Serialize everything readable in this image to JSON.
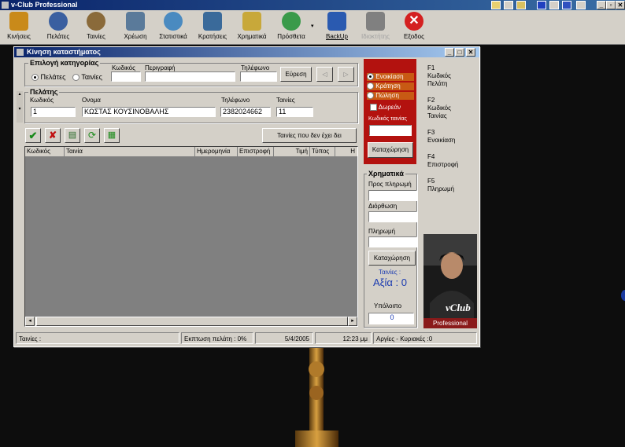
{
  "app": {
    "title": "v-Club Professional"
  },
  "toolbar": {
    "items": [
      {
        "label": "Κινήσεις",
        "color": "#c98a1a",
        "enabled": true
      },
      {
        "label": "Πελάτες",
        "color": "#3a5fa0",
        "enabled": true
      },
      {
        "label": "Ταινίες",
        "color": "#8a6a3a",
        "enabled": true
      },
      {
        "label": "Χρέωση",
        "color": "#5a7a9a",
        "enabled": true
      },
      {
        "label": "Στατιστικά",
        "color": "#4a8ac0",
        "enabled": true
      },
      {
        "label": "Κρατήσεις",
        "color": "#3a6a9a",
        "enabled": true
      },
      {
        "label": "Χρηματικά",
        "color": "#c8a83a",
        "enabled": true
      },
      {
        "label": "Πρόσθετα",
        "color": "#3a9a4a",
        "enabled": true
      },
      {
        "label": "BackUp",
        "color": "#2a5ab0",
        "enabled": true
      },
      {
        "label": "Ιδιοκτήτης",
        "color": "#808080",
        "enabled": false
      },
      {
        "label": "Εξοδος",
        "color": "#d42020",
        "enabled": true
      }
    ]
  },
  "window": {
    "title": "Κίνηση καταστήματος",
    "category": {
      "group_label": "Επιλογή κατηγορίας",
      "opt_customers": "Πελάτες",
      "opt_movies": "Ταινίες",
      "code_label": "Κωδικός",
      "desc_label": "Περιγραφή",
      "phone_label": "Τηλέφωνο",
      "search_button": "Εύρεση"
    },
    "customer": {
      "group_label": "Πελάτης",
      "code_label": "Κωδικός",
      "code_value": "1",
      "name_label": "Ονομα",
      "name_value": "ΚΩΣΤΑΣ ΚΟΥΣΙΝΟΒΑΛΗΣ",
      "phone_label": "Τηλέφωνο",
      "phone_value": "2382024662",
      "movies_label": "Ταινίες",
      "movies_value": "11"
    },
    "not_had_button": "Ταινίες που δεν έχει δει",
    "grid_columns": [
      "Κωδικός",
      "Ταινία",
      "Ημερομηνία",
      "Επιστροφή",
      "Τιμή",
      "Τύπος",
      "Η"
    ],
    "rental": {
      "opt_rent": "Ενοικίαση",
      "opt_reserve": "Κράτηση",
      "opt_sale": "Πώληση",
      "free_label": "Δωρεάν",
      "movie_code_label": "Κωδικός ταινίας",
      "save_button": "Καταχώρηση"
    },
    "money": {
      "group_label": "Χρηματικά",
      "to_pay_label": "Προς πληρωμή",
      "correction_label": "Διόρθωση",
      "payment_label": "Πληρωμή",
      "save_button": "Καταχώρηση",
      "movies_label": "Ταινίες :",
      "value_label": "Αξία : 0",
      "balance_label": "Υπόλοιπο",
      "balance_value": "0"
    },
    "shortcuts": [
      {
        "key": "F1",
        "text": "Κωδικός Πελάτη"
      },
      {
        "key": "F2",
        "text": "Κωδικός Ταινίας"
      },
      {
        "key": "F3",
        "text": "Ενοικίαση"
      },
      {
        "key": "F4",
        "text": "Επιστροφή"
      },
      {
        "key": "F5",
        "text": "Πληρωμή"
      }
    ],
    "photo": {
      "brand": "vClub",
      "edition": "Professional"
    },
    "status": {
      "movies": "Ταινίες :",
      "discount": "Εκπτωση πελάτη : 0%",
      "date": "5/4/2005",
      "time": "12:23 μμ",
      "holidays": "Αργίες - Κυριακές :0"
    }
  }
}
